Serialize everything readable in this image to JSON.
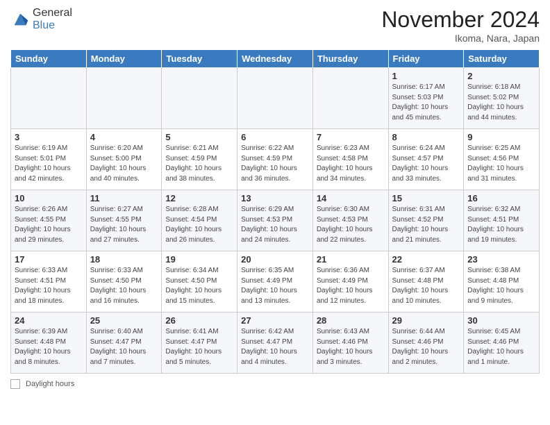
{
  "header": {
    "logo_general": "General",
    "logo_blue": "Blue",
    "month_title": "November 2024",
    "subtitle": "Ikoma, Nara, Japan"
  },
  "days_of_week": [
    "Sunday",
    "Monday",
    "Tuesday",
    "Wednesday",
    "Thursday",
    "Friday",
    "Saturday"
  ],
  "weeks": [
    [
      {
        "day": "",
        "info": ""
      },
      {
        "day": "",
        "info": ""
      },
      {
        "day": "",
        "info": ""
      },
      {
        "day": "",
        "info": ""
      },
      {
        "day": "",
        "info": ""
      },
      {
        "day": "1",
        "info": "Sunrise: 6:17 AM\nSunset: 5:03 PM\nDaylight: 10 hours\nand 45 minutes."
      },
      {
        "day": "2",
        "info": "Sunrise: 6:18 AM\nSunset: 5:02 PM\nDaylight: 10 hours\nand 44 minutes."
      }
    ],
    [
      {
        "day": "3",
        "info": "Sunrise: 6:19 AM\nSunset: 5:01 PM\nDaylight: 10 hours\nand 42 minutes."
      },
      {
        "day": "4",
        "info": "Sunrise: 6:20 AM\nSunset: 5:00 PM\nDaylight: 10 hours\nand 40 minutes."
      },
      {
        "day": "5",
        "info": "Sunrise: 6:21 AM\nSunset: 4:59 PM\nDaylight: 10 hours\nand 38 minutes."
      },
      {
        "day": "6",
        "info": "Sunrise: 6:22 AM\nSunset: 4:59 PM\nDaylight: 10 hours\nand 36 minutes."
      },
      {
        "day": "7",
        "info": "Sunrise: 6:23 AM\nSunset: 4:58 PM\nDaylight: 10 hours\nand 34 minutes."
      },
      {
        "day": "8",
        "info": "Sunrise: 6:24 AM\nSunset: 4:57 PM\nDaylight: 10 hours\nand 33 minutes."
      },
      {
        "day": "9",
        "info": "Sunrise: 6:25 AM\nSunset: 4:56 PM\nDaylight: 10 hours\nand 31 minutes."
      }
    ],
    [
      {
        "day": "10",
        "info": "Sunrise: 6:26 AM\nSunset: 4:55 PM\nDaylight: 10 hours\nand 29 minutes."
      },
      {
        "day": "11",
        "info": "Sunrise: 6:27 AM\nSunset: 4:55 PM\nDaylight: 10 hours\nand 27 minutes."
      },
      {
        "day": "12",
        "info": "Sunrise: 6:28 AM\nSunset: 4:54 PM\nDaylight: 10 hours\nand 26 minutes."
      },
      {
        "day": "13",
        "info": "Sunrise: 6:29 AM\nSunset: 4:53 PM\nDaylight: 10 hours\nand 24 minutes."
      },
      {
        "day": "14",
        "info": "Sunrise: 6:30 AM\nSunset: 4:53 PM\nDaylight: 10 hours\nand 22 minutes."
      },
      {
        "day": "15",
        "info": "Sunrise: 6:31 AM\nSunset: 4:52 PM\nDaylight: 10 hours\nand 21 minutes."
      },
      {
        "day": "16",
        "info": "Sunrise: 6:32 AM\nSunset: 4:51 PM\nDaylight: 10 hours\nand 19 minutes."
      }
    ],
    [
      {
        "day": "17",
        "info": "Sunrise: 6:33 AM\nSunset: 4:51 PM\nDaylight: 10 hours\nand 18 minutes."
      },
      {
        "day": "18",
        "info": "Sunrise: 6:33 AM\nSunset: 4:50 PM\nDaylight: 10 hours\nand 16 minutes."
      },
      {
        "day": "19",
        "info": "Sunrise: 6:34 AM\nSunset: 4:50 PM\nDaylight: 10 hours\nand 15 minutes."
      },
      {
        "day": "20",
        "info": "Sunrise: 6:35 AM\nSunset: 4:49 PM\nDaylight: 10 hours\nand 13 minutes."
      },
      {
        "day": "21",
        "info": "Sunrise: 6:36 AM\nSunset: 4:49 PM\nDaylight: 10 hours\nand 12 minutes."
      },
      {
        "day": "22",
        "info": "Sunrise: 6:37 AM\nSunset: 4:48 PM\nDaylight: 10 hours\nand 10 minutes."
      },
      {
        "day": "23",
        "info": "Sunrise: 6:38 AM\nSunset: 4:48 PM\nDaylight: 10 hours\nand 9 minutes."
      }
    ],
    [
      {
        "day": "24",
        "info": "Sunrise: 6:39 AM\nSunset: 4:48 PM\nDaylight: 10 hours\nand 8 minutes."
      },
      {
        "day": "25",
        "info": "Sunrise: 6:40 AM\nSunset: 4:47 PM\nDaylight: 10 hours\nand 7 minutes."
      },
      {
        "day": "26",
        "info": "Sunrise: 6:41 AM\nSunset: 4:47 PM\nDaylight: 10 hours\nand 5 minutes."
      },
      {
        "day": "27",
        "info": "Sunrise: 6:42 AM\nSunset: 4:47 PM\nDaylight: 10 hours\nand 4 minutes."
      },
      {
        "day": "28",
        "info": "Sunrise: 6:43 AM\nSunset: 4:46 PM\nDaylight: 10 hours\nand 3 minutes."
      },
      {
        "day": "29",
        "info": "Sunrise: 6:44 AM\nSunset: 4:46 PM\nDaylight: 10 hours\nand 2 minutes."
      },
      {
        "day": "30",
        "info": "Sunrise: 6:45 AM\nSunset: 4:46 PM\nDaylight: 10 hours\nand 1 minute."
      }
    ]
  ],
  "legend": {
    "label": "Daylight hours"
  }
}
